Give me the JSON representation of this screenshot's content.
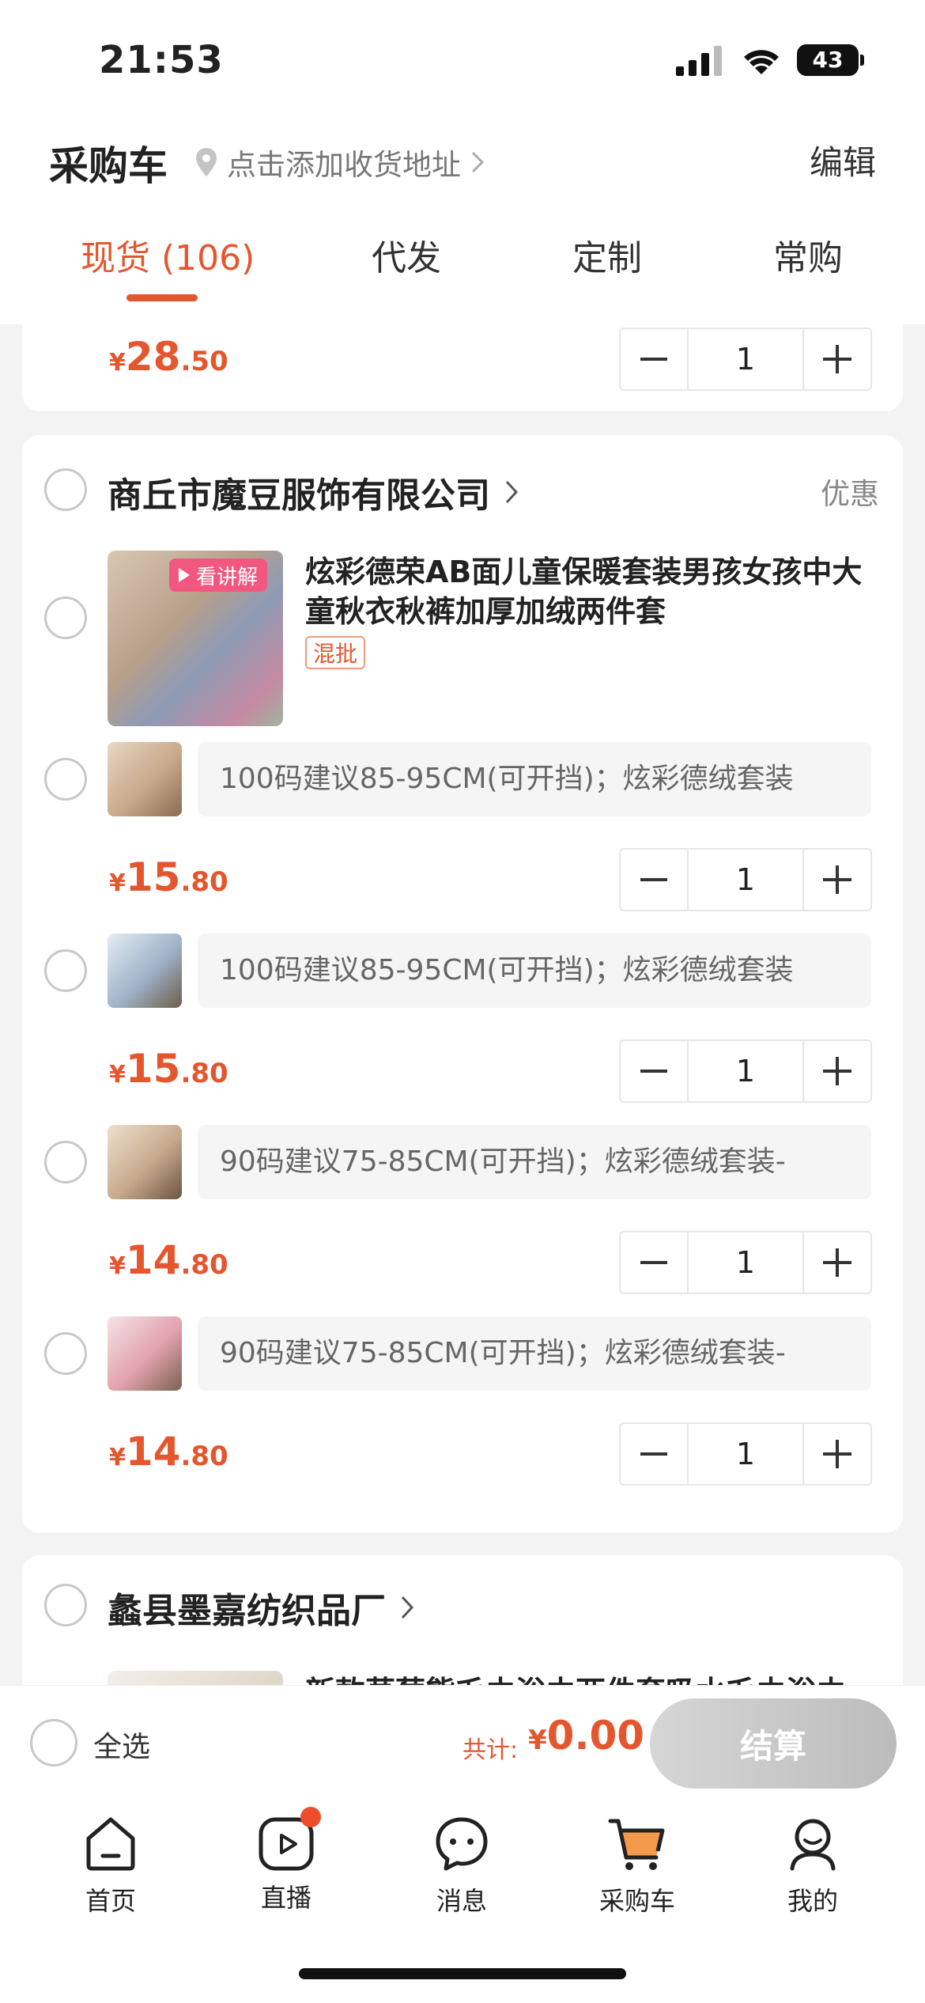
{
  "status_bar": {
    "time": "21:53",
    "battery": "43"
  },
  "header": {
    "title": "采购车",
    "address_prompt": "点击添加收货地址",
    "edit_label": "编辑",
    "tabs": [
      "现货 (106)",
      "代发",
      "定制",
      "常购"
    ],
    "active_tab": 0
  },
  "top_item": {
    "price_int": "28",
    "price_dec": ".50",
    "qty": "1"
  },
  "shop1": {
    "name": "商丘市魔豆服饰有限公司",
    "promo": "优惠",
    "product": {
      "live_tag": "看讲解",
      "title": "炫彩德荣AB面儿童保暖套装男孩女孩中大童秋衣秋裤加厚加绒两件套",
      "tag": "混批"
    },
    "variants": [
      {
        "spec": "100码建议85-95CM(可开挡)；炫彩德绒套装",
        "price_int": "15",
        "price_dec": ".80",
        "qty": "1",
        "color": "#c9a98a"
      },
      {
        "spec": "100码建议85-95CM(可开挡)；炫彩德绒套装",
        "price_int": "15",
        "price_dec": ".80",
        "qty": "1",
        "color": "#9fb3c8"
      },
      {
        "spec": "90码建议75-85CM(可开挡)；炫彩德绒套装-",
        "price_int": "14",
        "price_dec": ".80",
        "qty": "1",
        "color": "#c7a98c"
      },
      {
        "spec": "90码建议75-85CM(可开挡)；炫彩德绒套装-",
        "price_int": "14",
        "price_dec": ".80",
        "qty": "1",
        "color": "#e2a2ad"
      }
    ]
  },
  "shop2": {
    "name": "蠡县墨嘉纺织品厂",
    "product_title_partial": "新款草莓熊毛巾浴巾两件套吸水毛巾浴巾"
  },
  "currency": "¥",
  "checkout": {
    "select_all": "全选",
    "total_label": "共计:",
    "total_value": "0.00",
    "pay_label": "结算"
  },
  "tabbar": {
    "items": [
      "首页",
      "直播",
      "消息",
      "采购车",
      "我的"
    ]
  },
  "colors": {
    "accent": "#e4572e",
    "background": "#f3f3f3"
  }
}
